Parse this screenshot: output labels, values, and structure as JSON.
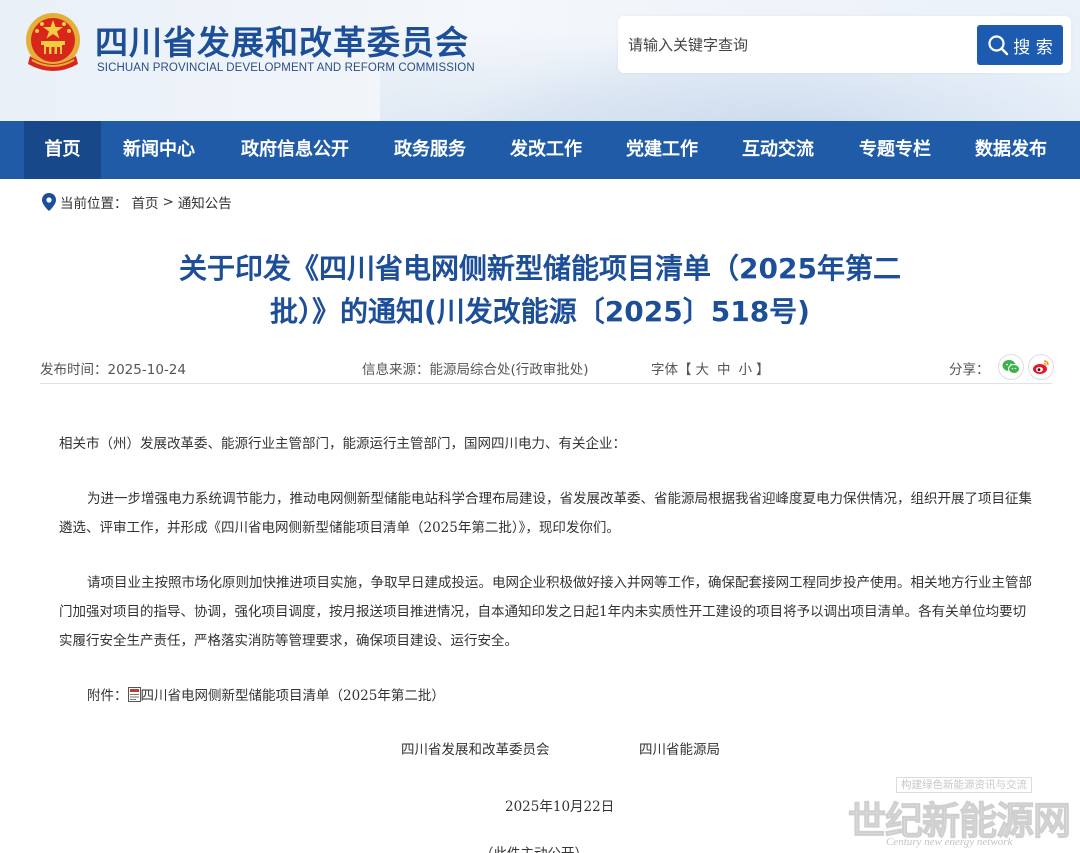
{
  "header": {
    "title": "四川省发展和改革委员会",
    "subtitle": "SICHUAN PROVINCIAL DEVELOPMENT AND REFORM COMMISSION",
    "search_placeholder": "请输入关键字查询",
    "search_button": "搜 索"
  },
  "nav": {
    "items": [
      "首页",
      "新闻中心",
      "政府信息公开",
      "政务服务",
      "发改工作",
      "党建工作",
      "互动交流",
      "专题专栏",
      "数据发布"
    ],
    "active": "首页"
  },
  "breadcrumb": {
    "label": "当前位置：",
    "home": "首页",
    "separator": ">",
    "current": "通知公告"
  },
  "article": {
    "title_line1": "关于印发《四川省电网侧新型储能项目清单（2025年第二",
    "title_line2": "批）》的通知(川发改能源〔2025〕518号)",
    "publish_time": "发布时间：2025-10-24",
    "source": "信息来源：能源局综合处(行政审批处)",
    "font_label_prefix": "字体【",
    "font_large": "大",
    "font_medium": "中",
    "font_small": "小",
    "font_label_suffix": "】",
    "share_label": "分享：",
    "salutation": "相关市（州）发展改革委、能源行业主管部门，能源运行主管部门，国网四川电力、有关企业：",
    "paragraph1": "为进一步增强电力系统调节能力，推动电网侧新型储能电站科学合理布局建设，省发展改革委、省能源局根据我省迎峰度夏电力保供情况，组织开展了项目征集遴选、评审工作，并形成《四川省电网侧新型储能项目清单（2025年第二批）》，现印发你们。",
    "paragraph2": "请项目业主按照市场化原则加快推进项目实施，争取早日建成投运。电网企业积极做好接入并网等工作，确保配套接网工程同步投产使用。相关地方行业主管部门加强对项目的指导、协调，强化项目调度，按月报送项目推进情况，自本通知印发之日起1年内未实质性开工建设的项目将予以调出项目清单。各有关单位均要切实履行安全生产责任，严格落实消防等管理要求，确保项目建设、运行安全。",
    "attachment_label": "附件：",
    "attachment_name": "四川省电网侧新型储能项目清单（2025年第二批）",
    "signer1": "四川省发展和改革委员会",
    "signer2": "四川省能源局",
    "date": "2025年10月22日",
    "cut_text": "（此件主动公开）"
  },
  "watermark": {
    "top": "构建绿色新能源资讯与交流",
    "main": "世纪新能源网",
    "sub": "Century new energy network"
  },
  "icons": {
    "location": "location-pin-icon",
    "search": "search-icon",
    "wechat": "wechat-icon",
    "weibo": "weibo-icon",
    "pdf": "pdf-file-icon"
  },
  "colors": {
    "brand_blue": "#1d4f99",
    "nav_blue": "#1f5ba6",
    "nav_active": "#17498a",
    "button_blue": "#1c5bb0",
    "wechat_green": "#3bb34a",
    "weibo_red": "#e6162d"
  }
}
